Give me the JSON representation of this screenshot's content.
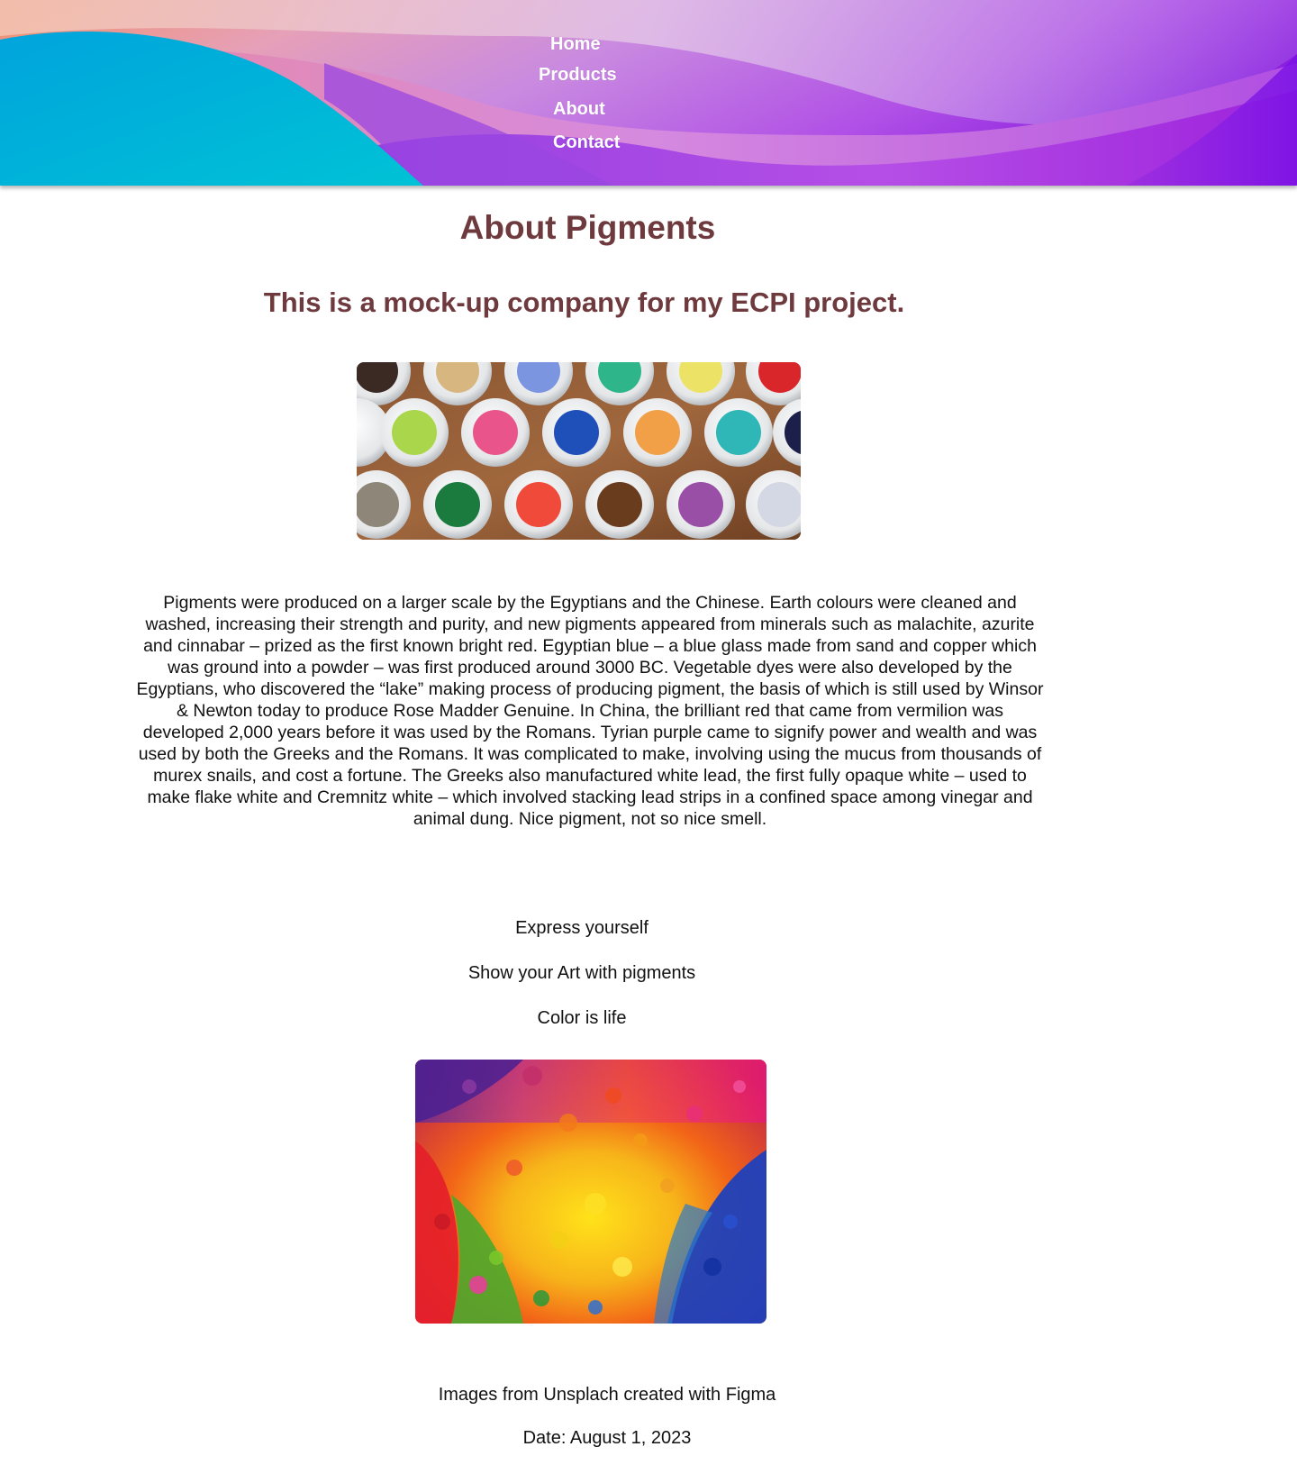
{
  "nav": {
    "items": [
      {
        "label": "Home"
      },
      {
        "label": "Products"
      },
      {
        "label": "About"
      },
      {
        "label": "Contact"
      }
    ]
  },
  "main": {
    "title": "About Pigments",
    "subtitle": "This is a mock-up company for my ECPI project.",
    "paragraph": "Pigments were produced on a larger scale by the Egyptians and the Chinese. Earth colours were cleaned and washed, increasing their strength and purity, and new pigments appeared from minerals such as malachite, azurite and cinnabar – prized as the first known bright red. Egyptian blue – a blue glass made from sand and copper which was ground into a powder – was first produced around 3000 BC. Vegetable dyes were also developed by the Egyptians, who discovered the “lake” making process of producing pigment, the basis of which is still used by Winsor & Newton today to produce Rose Madder Genuine. In China, the brilliant red that came from vermilion was developed 2,000 years before it was used by the Romans. Tyrian purple came to signify power and wealth and was used by both the Greeks and the Romans. It was complicated to make, involving using the mucus from thousands of murex snails, and cost a fortune. The Greeks also manufactured white lead, the first fully opaque white – used to make flake white and Cremnitz white – which involved stacking lead strips in a confined space among vinegar and animal dung. Nice pigment, not so nice smell.",
    "taglines": [
      "Express yourself",
      "Show your Art with pigments",
      "Color is life"
    ]
  },
  "footer": {
    "credit": "Images from Unsplach created with Figma",
    "date": "Date: August 1, 2023"
  },
  "colors": {
    "heading": "#6e3a3e",
    "nav_text": "#ffffff",
    "body_text": "#111111",
    "banner_purple": "#9b27e0",
    "banner_cyan": "#00b4d8"
  }
}
